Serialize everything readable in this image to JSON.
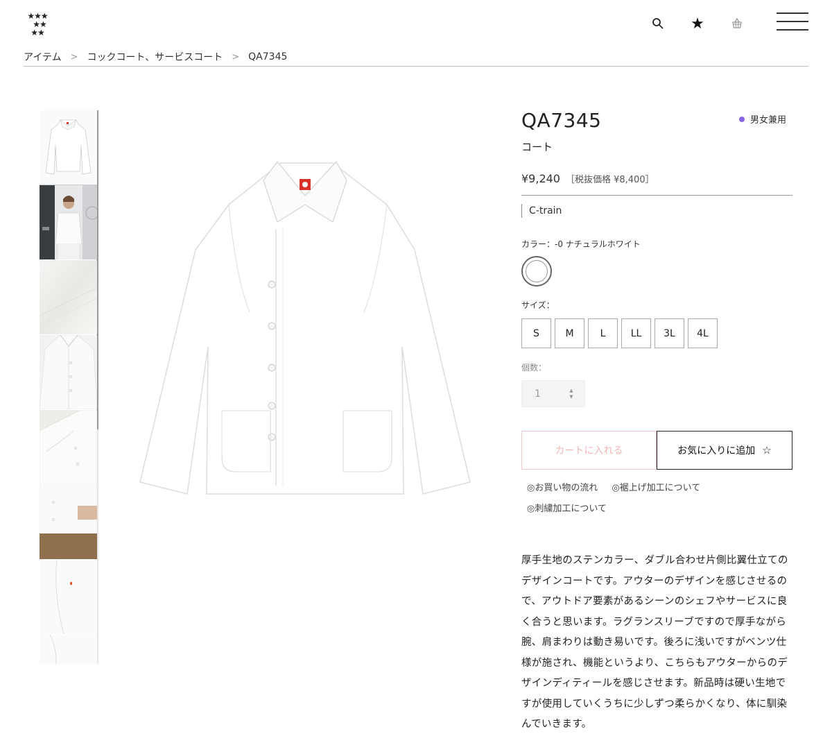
{
  "header": {
    "logo_alt": "★★★",
    "breadcrumb": [
      "アイテム",
      "コックコート、サービスコート",
      "QA7345"
    ],
    "breadcrumb_sep": ">"
  },
  "product": {
    "code": "QA7345",
    "type": "コート",
    "gender": "男女兼用",
    "price": "¥9,240",
    "price_tax": "［税抜価格 ¥8,400］",
    "brand": "C-train",
    "color_label": "カラー：-0 ナチュラルホワイト",
    "size_label": "サイズ：",
    "sizes": [
      "S",
      "M",
      "L",
      "LL",
      "3L",
      "4L"
    ],
    "qty_label": "個数：",
    "qty_value": "1",
    "cart_label": "カートに入れる",
    "fav_label": "お気に入りに追加",
    "fav_star": "☆",
    "links": [
      "◎お買い物の流れ",
      "◎裾上げ加工について",
      "◎刺繍加工について"
    ],
    "description": "厚手生地のステンカラー、ダブル合わせ片側比翼仕立てのデザインコートです。アウターのデザインを感じさせるので、アウトドア要素があるシーンのシェフやサービスに良く合うと思います。ラグランスリーブですので厚手ながら腕、肩まわりは動き易いです。後ろに浅いですがベンツ仕様が施され、機能というより、こちらもアウターからのデザインディティールを感じさせます。新品時は硬い生地ですが使用していくうちに少しずつ柔らかくなり、体に馴染んでいきます。"
  },
  "colors": {
    "gender_dot": "#8a63e8",
    "cart_text": "#f2b8b8",
    "cart_border": "#f0c8c8"
  },
  "icons": {
    "search": "search-icon",
    "favorite": "star-icon",
    "cart": "basket-icon",
    "menu": "hamburger-icon"
  }
}
